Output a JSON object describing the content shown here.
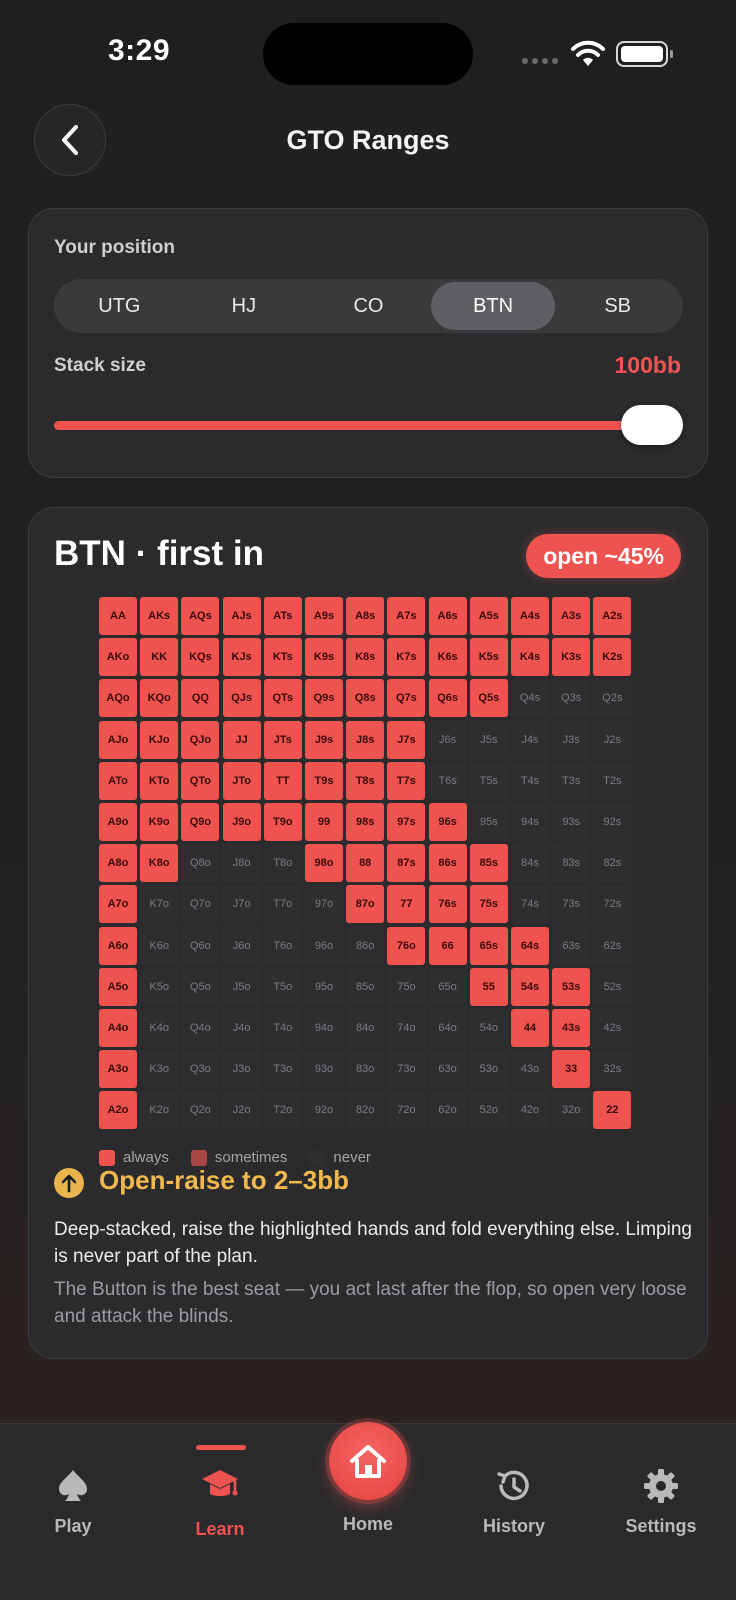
{
  "status_bar": {
    "time": "3:29"
  },
  "header": {
    "title": "GTO Ranges"
  },
  "position_card": {
    "position_label": "Your position",
    "positions": [
      "UTG",
      "HJ",
      "CO",
      "BTN",
      "SB"
    ],
    "selected_position": "BTN",
    "stack_label": "Stack size",
    "stack_value": "100bb",
    "stack_slider_fraction": 1.0
  },
  "range_card": {
    "title": "BTN · first in",
    "badge": "open ~45%",
    "matrix": {
      "ranks": [
        "A",
        "K",
        "Q",
        "J",
        "T",
        "9",
        "8",
        "7",
        "6",
        "5",
        "4",
        "3",
        "2"
      ],
      "hands": [
        [
          "AA",
          "AKs",
          "AQs",
          "AJs",
          "ATs",
          "A9s",
          "A8s",
          "A7s",
          "A6s",
          "A5s",
          "A4s",
          "A3s",
          "A2s"
        ],
        [
          "AKo",
          "KK",
          "KQs",
          "KJs",
          "KTs",
          "K9s",
          "K8s",
          "K7s",
          "K6s",
          "K5s",
          "K4s",
          "K3s",
          "K2s"
        ],
        [
          "AQo",
          "KQo",
          "QQ",
          "QJs",
          "QTs",
          "Q9s",
          "Q8s",
          "Q7s",
          "Q6s",
          "Q5s",
          "Q4s",
          "Q3s",
          "Q2s"
        ],
        [
          "AJo",
          "KJo",
          "QJo",
          "JJ",
          "JTs",
          "J9s",
          "J8s",
          "J7s",
          "J6s",
          "J5s",
          "J4s",
          "J3s",
          "J2s"
        ],
        [
          "ATo",
          "KTo",
          "QTo",
          "JTo",
          "TT",
          "T9s",
          "T8s",
          "T7s",
          "T6s",
          "T5s",
          "T4s",
          "T3s",
          "T2s"
        ],
        [
          "A9o",
          "K9o",
          "Q9o",
          "J9o",
          "T9o",
          "99",
          "98s",
          "97s",
          "96s",
          "95s",
          "94s",
          "93s",
          "92s"
        ],
        [
          "A8o",
          "K8o",
          "Q8o",
          "J8o",
          "T8o",
          "98o",
          "88",
          "87s",
          "86s",
          "85s",
          "84s",
          "83s",
          "82s"
        ],
        [
          "A7o",
          "K7o",
          "Q7o",
          "J7o",
          "T7o",
          "97o",
          "87o",
          "77",
          "76s",
          "75s",
          "74s",
          "73s",
          "72s"
        ],
        [
          "A6o",
          "K6o",
          "Q6o",
          "J6o",
          "T6o",
          "96o",
          "86o",
          "76o",
          "66",
          "65s",
          "64s",
          "63s",
          "62s"
        ],
        [
          "A5o",
          "K5o",
          "Q5o",
          "J5o",
          "T5o",
          "95o",
          "85o",
          "75o",
          "65o",
          "55",
          "54s",
          "53s",
          "52s"
        ],
        [
          "A4o",
          "K4o",
          "Q4o",
          "J4o",
          "T4o",
          "94o",
          "84o",
          "74o",
          "64o",
          "54o",
          "44",
          "43s",
          "42s"
        ],
        [
          "A3o",
          "K3o",
          "Q3o",
          "J3o",
          "T3o",
          "93o",
          "83o",
          "73o",
          "63o",
          "53o",
          "43o",
          "33",
          "32s"
        ],
        [
          "A2o",
          "K2o",
          "Q2o",
          "J2o",
          "T2o",
          "92o",
          "82o",
          "72o",
          "62o",
          "52o",
          "42o",
          "32o",
          "22"
        ]
      ],
      "actions": [
        "AAAAAAAAAAAAA",
        "AAAAAAAAAAAAA",
        "AAAAAAAAAANNN",
        "AAAAAAAANNNNN",
        "AAAAAAAANNNNN",
        "AAAAAAAAANNNN",
        "AANNNAAAAANNN",
        "ANNNNNAAAANNN",
        "ANNNNNNAAAANN",
        "ANNNNNNNNAAAN",
        "ANNNNNNNNNAAN",
        "ANNNNNNNNNNAN",
        "ANNNNNNNNNNNA"
      ]
    },
    "legend": [
      {
        "label": "always",
        "color": "#ef5350"
      },
      {
        "label": "sometimes",
        "color": "#a94645"
      },
      {
        "label": "never",
        "color": "#2e2e31"
      }
    ],
    "advice_title": "Open-raise to 2–3bb",
    "advice_text": "Deep-stacked, raise the highlighted hands and fold everything else. Limping is never part of the plan.",
    "advice_sub": "The Button is the best seat — you act last after the flop, so open very loose and attack the blinds."
  },
  "tab_bar": {
    "tabs": [
      {
        "label": "Play",
        "icon": "spade-icon"
      },
      {
        "label": "Learn",
        "icon": "graduation-cap-icon",
        "active": true
      },
      {
        "label": "Home",
        "icon": "home-icon"
      },
      {
        "label": "History",
        "icon": "history-icon"
      },
      {
        "label": "Settings",
        "icon": "gear-icon"
      }
    ]
  },
  "colors": {
    "accent": "#ef5350",
    "warning": "#f0b84e",
    "card": "#2b2b2e"
  }
}
